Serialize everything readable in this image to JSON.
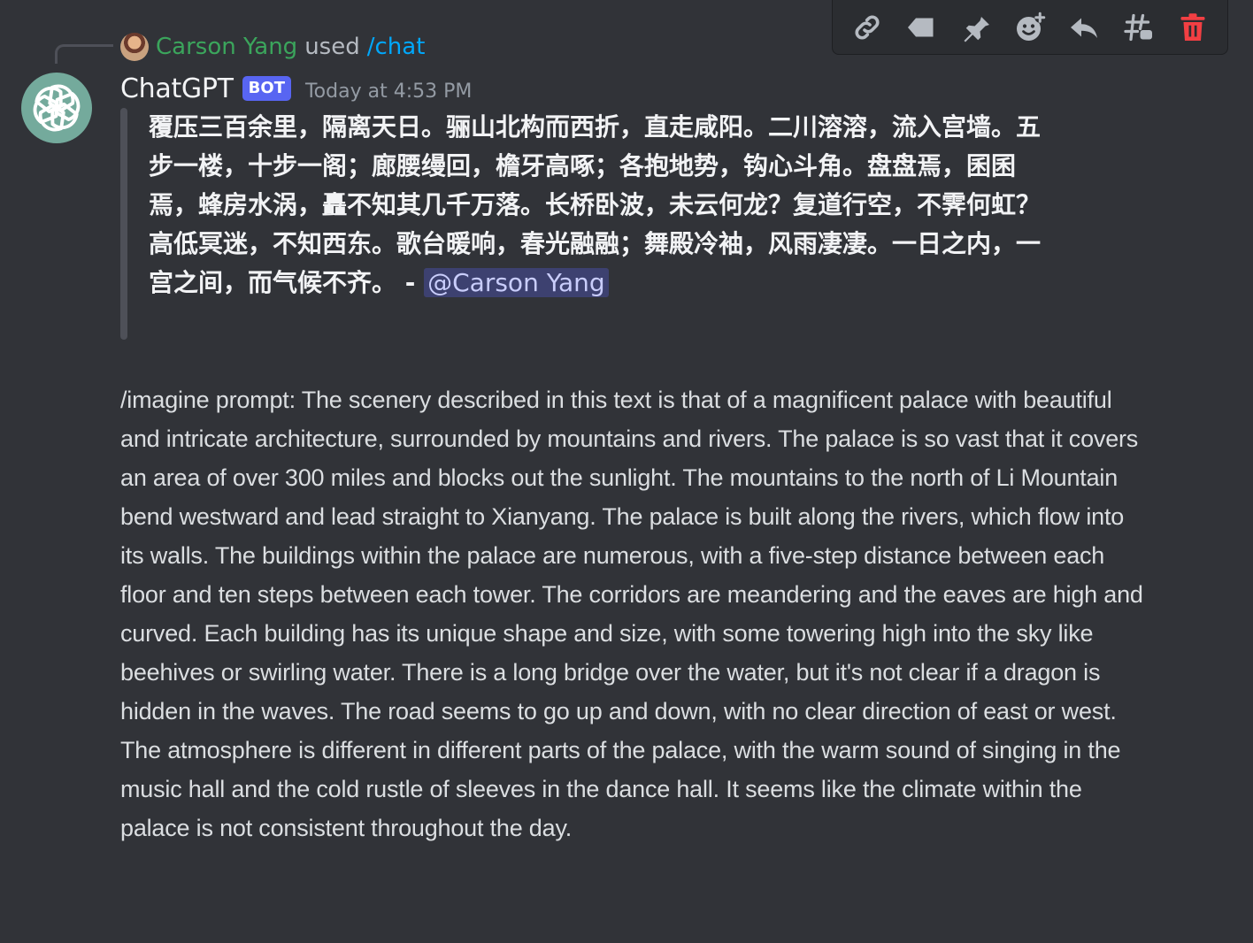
{
  "toolbar": {
    "buttons": [
      {
        "name": "copy-link-icon"
      },
      {
        "name": "tag-icon"
      },
      {
        "name": "pin-icon"
      },
      {
        "name": "add-reaction-icon"
      },
      {
        "name": "reply-icon"
      },
      {
        "name": "create-thread-icon"
      },
      {
        "name": "delete-icon"
      }
    ],
    "delete_color": "#f23f43"
  },
  "reply": {
    "user": "Carson Yang",
    "action": "used",
    "command": "/chat",
    "user_color": "#3ba55c",
    "command_color": "#00a8fc"
  },
  "message": {
    "username": "ChatGPT",
    "badge": "BOT",
    "timestamp": "Today at 4:53 PM",
    "avatar_color": "#74aa9c",
    "quote_text": "覆压三百余里，隔离天日。骊山北构而西折，直走咸阳。二川溶溶，流入宫墙。五步一楼，十步一阁；廊腰缦回，檐牙高啄；各抱地势，钩心斗角。盘盘焉，囷囷焉，蜂房水涡，矗不知其几千万落。长桥卧波，未云何龙？复道行空，不霁何虹？高低冥迷，不知西东。歌台暖响，春光融融；舞殿冷袖，风雨凄凄。一日之内，一宫之间，而气候不齐。 - ",
    "mention": "@Carson Yang",
    "body": "/imagine prompt: The scenery described in this text is that of a magnificent palace with beautiful and intricate architecture, surrounded by mountains and rivers. The palace is so vast that it covers an area of over 300 miles and blocks out the sunlight. The mountains to the north of Li Mountain bend westward and lead straight to Xianyang. The palace is built along the rivers, which flow into its walls. The buildings within the palace are numerous, with a five-step distance between each floor and ten steps between each tower. The corridors are meandering and the eaves are high and curved. Each building has its unique shape and size, with some towering high into the sky like beehives or swirling water. There is a long bridge over the water, but it's not clear if a dragon is hidden in the waves. The road seems to go up and down, with no clear direction of east or west. The atmosphere is different in different parts of the palace, with the warm sound of singing in the music hall and the cold rustle of sleeves in the dance hall. It seems like the climate within the palace is not consistent throughout the day."
  }
}
